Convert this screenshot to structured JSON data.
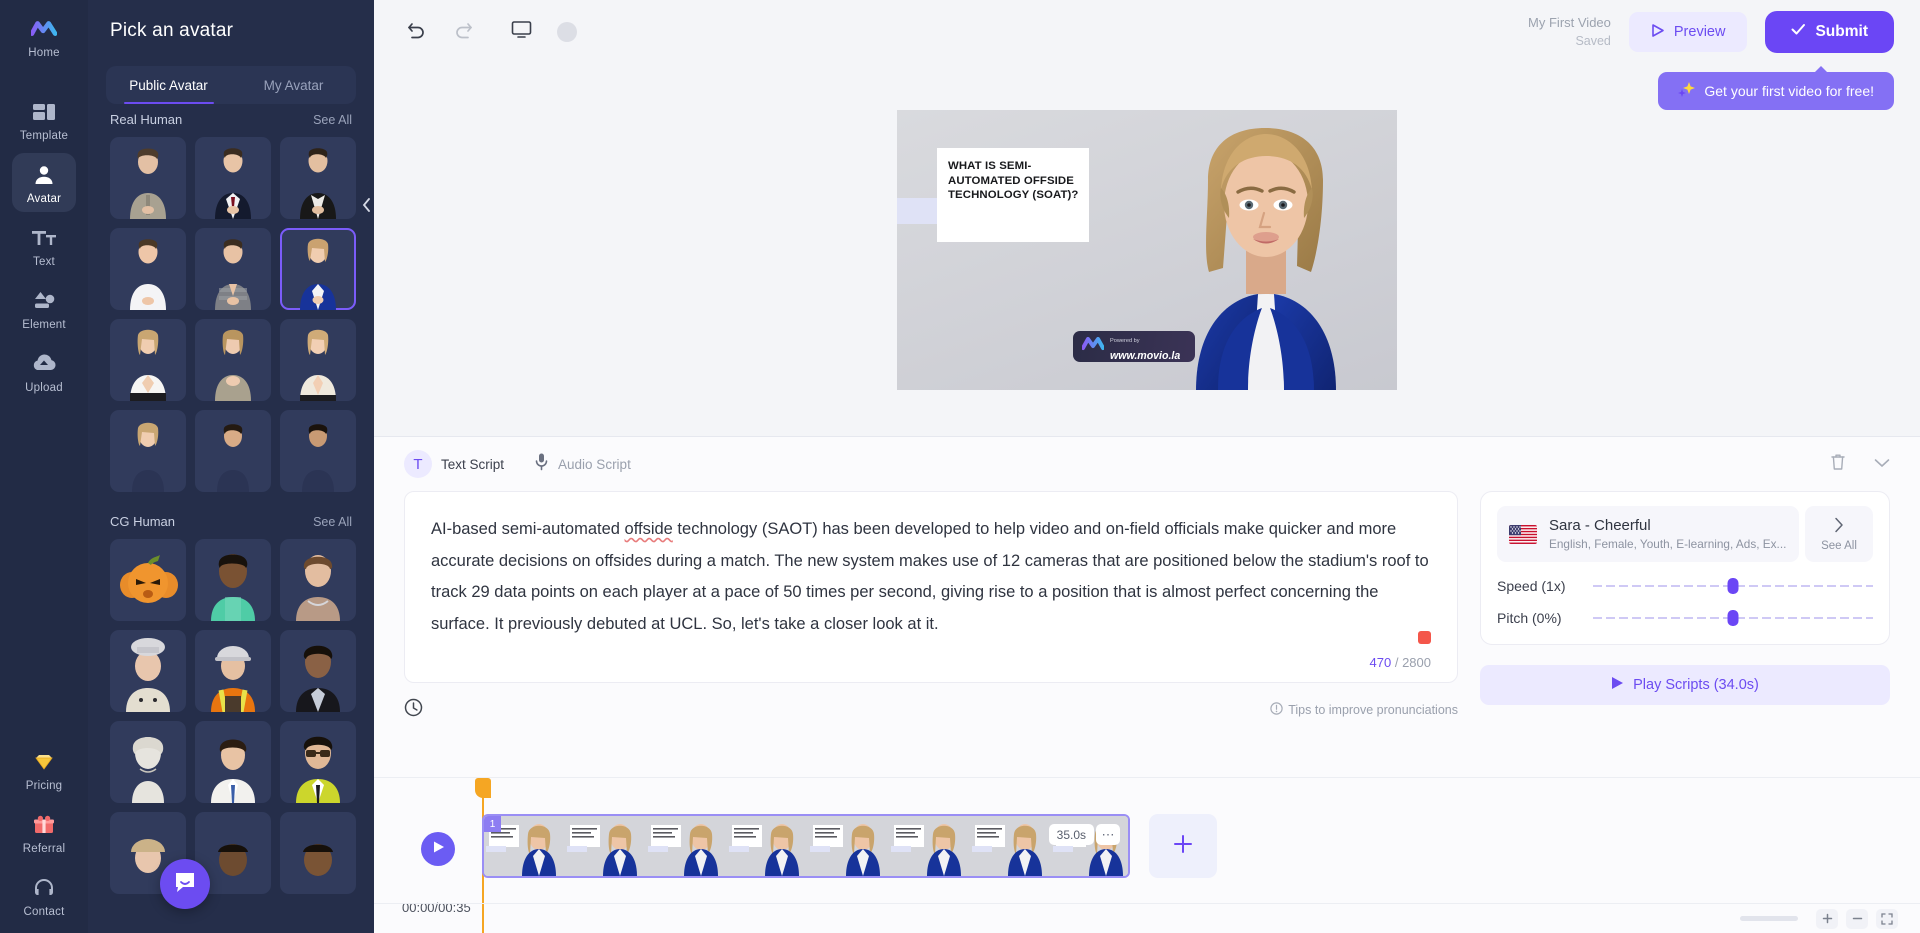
{
  "rail": {
    "items": [
      {
        "label": "Home",
        "icon": "logo-icon",
        "active": false
      },
      {
        "label": "Template",
        "icon": "template-icon",
        "active": false
      },
      {
        "label": "Avatar",
        "icon": "avatar-icon",
        "active": true
      },
      {
        "label": "Text",
        "icon": "text-icon",
        "active": false
      },
      {
        "label": "Element",
        "icon": "element-icon",
        "active": false
      },
      {
        "label": "Upload",
        "icon": "upload-icon",
        "active": false
      }
    ],
    "bottom_items": [
      {
        "label": "Pricing",
        "icon": "diamond-icon"
      },
      {
        "label": "Referral",
        "icon": "gift-icon"
      },
      {
        "label": "Contact",
        "icon": "headset-icon"
      }
    ]
  },
  "panel": {
    "title": "Pick an avatar",
    "tabs": [
      {
        "label": "Public Avatar",
        "active": true
      },
      {
        "label": "My Avatar",
        "active": false
      }
    ],
    "groups": [
      {
        "name": "Real Human",
        "see_all": "See All"
      },
      {
        "name": "CG Human",
        "see_all": "See All"
      }
    ],
    "collapse_icon": "chevron-left-icon",
    "selected_avatar_index": 5
  },
  "toolbar": {
    "undo_icon": "undo-icon",
    "redo_icon": "redo-icon",
    "screen_icon": "monitor-icon",
    "avatar_dot": "circle-icon",
    "video_title": "My First Video",
    "saved_status": "Saved",
    "preview_label": "Preview",
    "submit_label": "Submit",
    "promo_label": "Get your first video for free!",
    "promo_icon": "sparkle-icon"
  },
  "canvas": {
    "slide_heading": "WHAT IS SEMI-AUTOMATED OFFSIDE TECHNOLOGY (SOAT)?",
    "watermark_pre": "Powered by",
    "watermark_url": "www.movio.la"
  },
  "script": {
    "tabs": [
      {
        "label": "Text Script",
        "icon": "text-tool-icon",
        "active": true
      },
      {
        "label": "Audio Script",
        "icon": "microphone-icon",
        "active": false
      }
    ],
    "delete_icon": "trash-icon",
    "collapse_icon": "chevron-down-icon",
    "clock_icon": "clock-icon",
    "body_part1": "AI-based semi-automated ",
    "body_typo": "offside",
    "body_part2": " technology (SAOT) has been developed to help video and on-field officials make quicker and more accurate decisions on offsides during a match. The new system makes use of 12 cameras that are positioned below the stadium's roof to track 29 data points on each player at a pace of 50 times per second, giving rise to a position that is almost perfect concerning the surface. It previously debuted at UCL. So, let's take a closer look at it.",
    "char_count": "470",
    "char_limit": "/ 2800",
    "record_icon": "record-stop-icon",
    "tips_label": "Tips to improve pronunciations",
    "tips_icon": "info-icon"
  },
  "voice": {
    "flag_icon": "us-flag-icon",
    "name": "Sara - Cheerful",
    "description": "English, Female, Youth, E-learning, Ads, Ex...",
    "see_all_label": "See All",
    "see_all_icon": "chevron-right-icon",
    "speed_label": "Speed (1x)",
    "speed_percent": 50,
    "pitch_label": "Pitch (0%)",
    "pitch_percent": 50,
    "play_scripts_label": "Play Scripts (34.0s)",
    "play_icon": "play-icon"
  },
  "timeline": {
    "play_icon": "play-icon",
    "time_display": "00:00/00:35",
    "clip_number": "1",
    "clip_duration": "35.0s",
    "more_icon": "ellipsis-icon",
    "add_scene_icon": "plus-icon",
    "zoom_in_icon": "plus-icon",
    "zoom_out_icon": "minus-icon",
    "fit_icon": "fit-screen-icon"
  },
  "colors": {
    "brand_purple": "#6b46f5",
    "rail_bg": "#222b45",
    "panel_bg": "#252e4a",
    "accent_light": "#eceaff",
    "playhead": "#f5a623",
    "record": "#f4564a"
  }
}
